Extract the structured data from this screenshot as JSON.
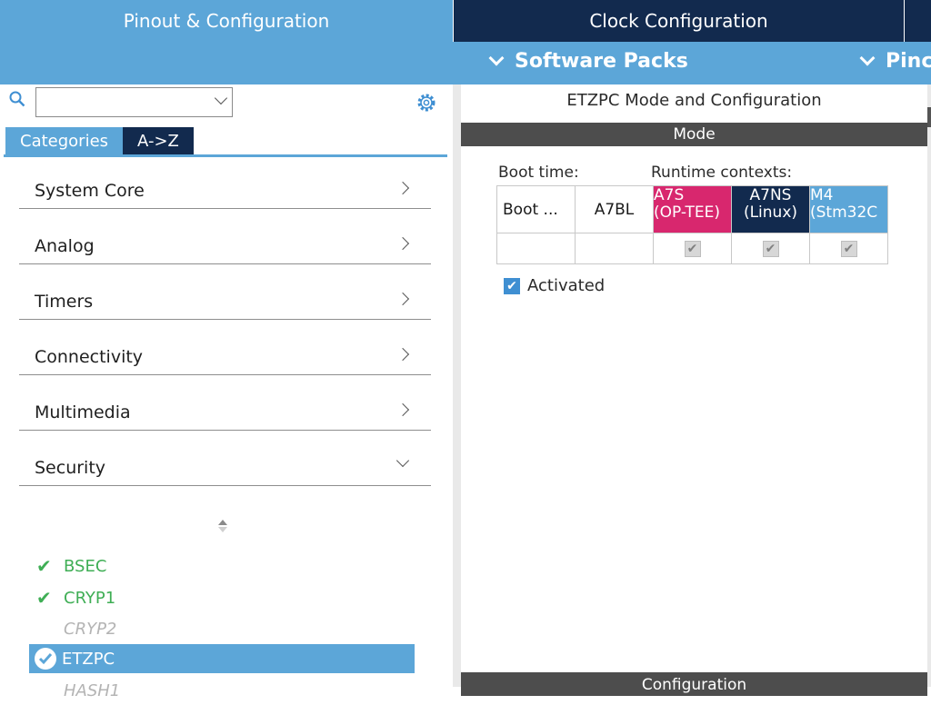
{
  "tabs": {
    "pinout": "Pinout & Configuration",
    "clock": "Clock Configuration"
  },
  "subbar": {
    "software_packs": "Software Packs",
    "pinout_partial": "Pinc"
  },
  "search": {
    "value": ""
  },
  "category_tabs": [
    "Categories",
    "A->Z"
  ],
  "categories": [
    {
      "label": "System Core"
    },
    {
      "label": "Analog"
    },
    {
      "label": "Timers"
    },
    {
      "label": "Connectivity"
    },
    {
      "label": "Multimedia"
    },
    {
      "label": "Security"
    }
  ],
  "security_items": [
    {
      "label": "BSEC",
      "state": "enabled"
    },
    {
      "label": "CRYP1",
      "state": "enabled"
    },
    {
      "label": "CRYP2",
      "state": "disabled"
    },
    {
      "label": "ETZPC",
      "state": "selected"
    },
    {
      "label": "HASH1",
      "state": "disabled"
    }
  ],
  "right": {
    "title": "ETZPC Mode and Configuration",
    "mode_header": "Mode",
    "boot_time_label": "Boot time:",
    "runtime_label": "Runtime contexts:",
    "boot_cell": "Boot ...",
    "a7bl_cell": "A7BL",
    "contexts": [
      {
        "line1": "A7S",
        "line2": "(OP-TEE)",
        "color": "#d8276e",
        "checked": true
      },
      {
        "line1": "A7NS",
        "line2": "(Linux)",
        "color": "#122a4e",
        "checked": true
      },
      {
        "line1": "M4",
        "line2": "(Stm32C",
        "color": "#5ca6d8",
        "checked": true
      }
    ],
    "activated_label": "Activated",
    "activated": true,
    "config_header": "Configuration"
  },
  "colors": {
    "accent": "#5ca6d8",
    "navy": "#122a4e",
    "ok_green": "#3fae55",
    "a7s_pink": "#d8276e"
  }
}
